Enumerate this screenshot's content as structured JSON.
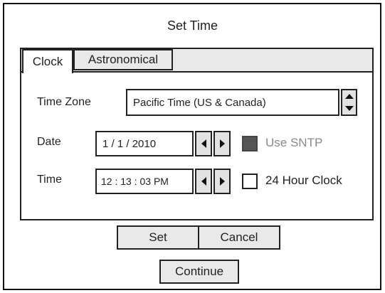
{
  "dialog": {
    "title": "Set Time"
  },
  "tabs": [
    {
      "label": "Clock",
      "active": true
    },
    {
      "label": "Astronomical",
      "active": false
    }
  ],
  "clock": {
    "timezone_label": "Time Zone",
    "timezone_value": "Pacific Time (US & Canada)",
    "date_label": "Date",
    "date_value": "1 / 1 / 2010",
    "time_label": "Time",
    "time_value": "12 : 13 : 03 PM",
    "use_sntp_label": "Use SNTP",
    "use_sntp_enabled": false,
    "hour24_label": "24 Hour Clock",
    "hour24_checked": false
  },
  "buttons": {
    "set": "Set",
    "cancel": "Cancel",
    "continue": "Continue"
  },
  "colors": {
    "tab_inactive_bg": "#e9e9e9",
    "disabled_text": "#8a8a8a",
    "disabled_checkbox": "#555555"
  },
  "icons": {
    "spinner_up": "triangle-up",
    "spinner_down": "triangle-down",
    "step_left": "triangle-left",
    "step_right": "triangle-right"
  }
}
